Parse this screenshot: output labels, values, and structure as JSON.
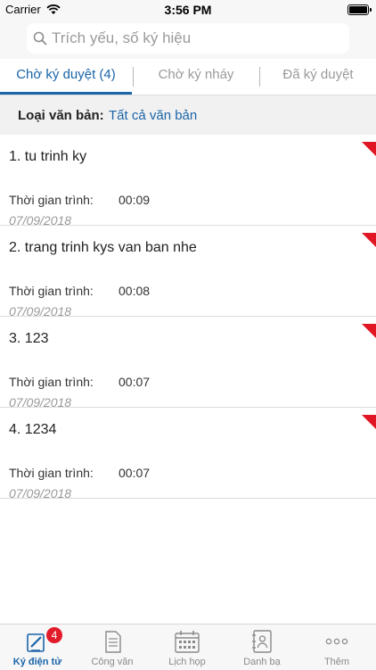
{
  "status_bar": {
    "carrier": "Carrier",
    "time": "3:56 PM"
  },
  "search": {
    "placeholder": "Trích yếu, số ký hiệu",
    "value": ""
  },
  "tabs": [
    {
      "label": "Chờ ký duyệt (4)",
      "active": true
    },
    {
      "label": "Chờ ký nháy",
      "active": false
    },
    {
      "label": "Đã ký duyệt",
      "active": false
    }
  ],
  "filter": {
    "label": "Loại văn bản:",
    "value": "Tất cả văn bản"
  },
  "documents": {
    "time_label": "Thời gian trình:",
    "items": [
      {
        "title": "1. tu trinh ky",
        "time": "00:09",
        "date": "07/09/2018"
      },
      {
        "title": "2. trang trinh kys van ban nhe",
        "time": "00:08",
        "date": "07/09/2018"
      },
      {
        "title": "3. 123",
        "time": "00:07",
        "date": "07/09/2018"
      },
      {
        "title": "4. 1234",
        "time": "00:07",
        "date": "07/09/2018"
      }
    ]
  },
  "tab_bar": {
    "items": [
      {
        "label": "Ký điện tử",
        "icon": "sign-pen-icon",
        "active": true,
        "badge": "4"
      },
      {
        "label": "Công văn",
        "icon": "document-icon",
        "active": false
      },
      {
        "label": "Lịch họp",
        "icon": "calendar-icon",
        "active": false
      },
      {
        "label": "Danh bạ",
        "icon": "contacts-icon",
        "active": false
      },
      {
        "label": "Thêm",
        "icon": "more-icon",
        "active": false
      }
    ]
  },
  "colors": {
    "accent": "#1a64a8",
    "flag": "#e01624",
    "badge": "#e21b2b"
  }
}
